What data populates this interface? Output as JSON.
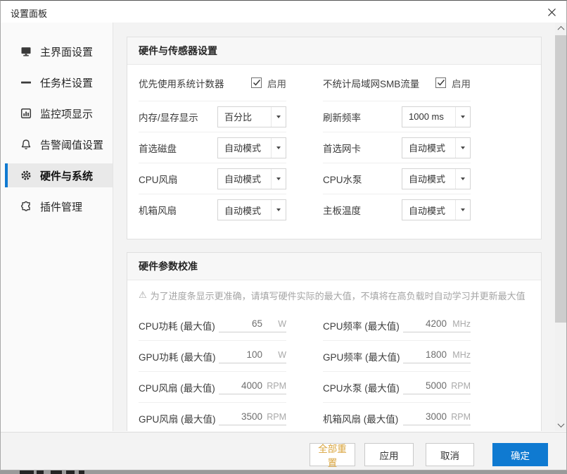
{
  "window": {
    "title": "设置面板"
  },
  "sidebar": {
    "items": [
      {
        "label": "主界面设置",
        "icon": "monitor-icon",
        "selected": false
      },
      {
        "label": "任务栏设置",
        "icon": "taskbar-icon",
        "selected": false
      },
      {
        "label": "监控项显示",
        "icon": "bar-chart-icon",
        "selected": false
      },
      {
        "label": "告警阈值设置",
        "icon": "bell-icon",
        "selected": false
      },
      {
        "label": "硬件与系统",
        "icon": "gear-icon",
        "selected": true
      },
      {
        "label": "插件管理",
        "icon": "plugin-icon",
        "selected": false
      }
    ]
  },
  "sections": {
    "sensor": {
      "title": "硬件与传感器设置",
      "checkbox_row": {
        "l_label": "优先使用系统计数器",
        "l_value": "启用",
        "l_checked": true,
        "r_label": "不统计局域网SMB流量",
        "r_value": "启用",
        "r_checked": true
      },
      "rows": [
        {
          "l_label": "内存/显存显示",
          "l_value": "百分比",
          "r_label": "刷新频率",
          "r_value": "1000 ms"
        },
        {
          "l_label": "首选磁盘",
          "l_value": "自动模式",
          "r_label": "首选网卡",
          "r_value": "自动模式"
        },
        {
          "l_label": "CPU风扇",
          "l_value": "自动模式",
          "r_label": "CPU水泵",
          "r_value": "自动模式"
        },
        {
          "l_label": "机箱风扇",
          "l_value": "自动模式",
          "r_label": "主板温度",
          "r_value": "自动模式"
        }
      ]
    },
    "calibration": {
      "title": "硬件参数校准",
      "warning_icon": "⚠",
      "warning": "为了进度条显示更准确，请填写硬件实际的最大值，不填将在高负载时自动学习并更新最大值",
      "rows": [
        {
          "l_label": "CPU功耗 (最大值)",
          "l_value": "65",
          "l_unit": "W",
          "r_label": "CPU频率 (最大值)",
          "r_value": "4200",
          "r_unit": "MHz"
        },
        {
          "l_label": "GPU功耗 (最大值)",
          "l_value": "100",
          "l_unit": "W",
          "r_label": "GPU频率 (最大值)",
          "r_value": "1800",
          "r_unit": "MHz"
        },
        {
          "l_label": "CPU风扇 (最大值)",
          "l_value": "4000",
          "l_unit": "RPM",
          "r_label": "CPU水泵 (最大值)",
          "r_value": "5000",
          "r_unit": "RPM"
        },
        {
          "l_label": "GPU风扇 (最大值)",
          "l_value": "3500",
          "l_unit": "RPM",
          "r_label": "机箱风扇 (最大值)",
          "r_value": "3000",
          "r_unit": "RPM"
        }
      ]
    }
  },
  "footer": {
    "reset": "全部重置",
    "apply": "应用",
    "cancel": "取消",
    "ok": "确定"
  },
  "colors": {
    "accent_blue": "#0f7ad1",
    "reset_orange": "#d9a43c",
    "selected_item_bg": "#e9e9e9"
  }
}
